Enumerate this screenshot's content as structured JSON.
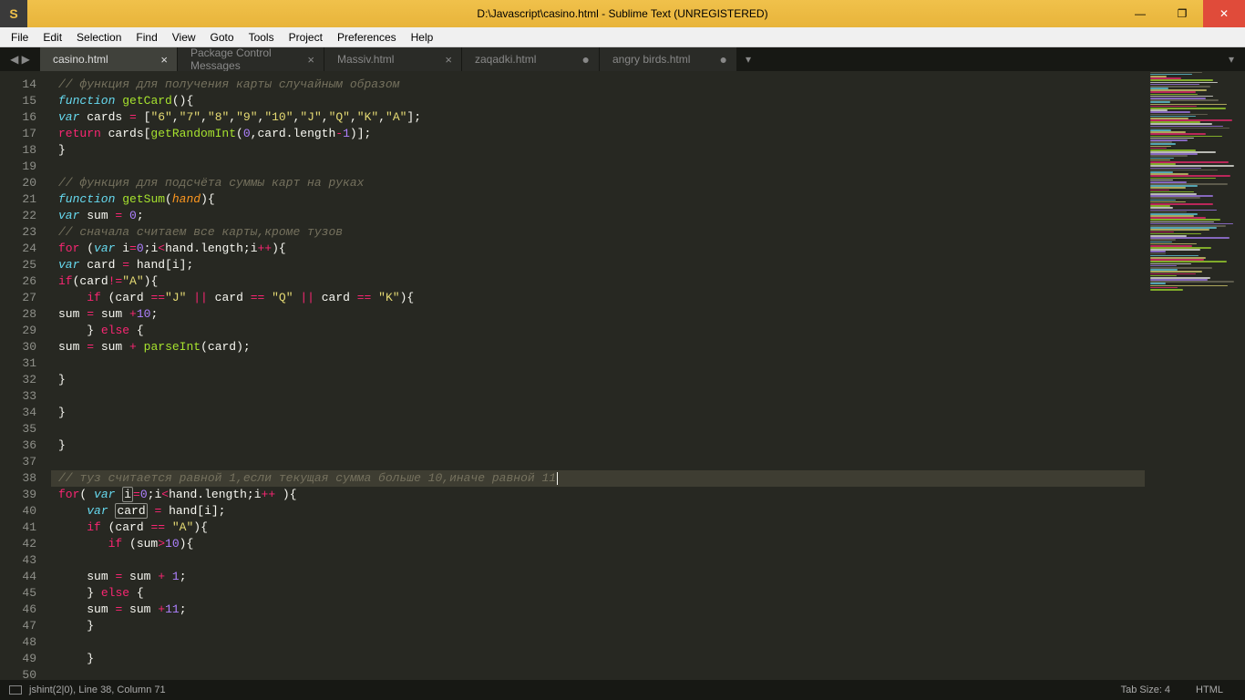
{
  "window": {
    "title": "D:\\Javascript\\casino.html - Sublime Text (UNREGISTERED)",
    "logo": "S"
  },
  "menu": {
    "items": [
      "File",
      "Edit",
      "Selection",
      "Find",
      "View",
      "Goto",
      "Tools",
      "Project",
      "Preferences",
      "Help"
    ]
  },
  "tabs": {
    "items": [
      {
        "label": "casino.html",
        "active": true,
        "close": true,
        "dirty": false
      },
      {
        "label": "Package Control Messages",
        "active": false,
        "close": true,
        "dirty": false
      },
      {
        "label": "Massiv.html",
        "active": false,
        "close": true,
        "dirty": false
      },
      {
        "label": "zaqadki.html",
        "active": false,
        "close": false,
        "dirty": true
      },
      {
        "label": "angry birds.html",
        "active": false,
        "close": false,
        "dirty": true
      }
    ]
  },
  "code": {
    "first_line": 14,
    "highlight_line": 38,
    "modified_lines": [
      39,
      40
    ],
    "lines": [
      {
        "t": "comment",
        "text": "// функция для получения карты случайным образом"
      },
      {
        "t": "fn_decl",
        "parts": {
          "kw": "function",
          "name": "getCard",
          "after": "(){"
        }
      },
      {
        "t": "var_arr",
        "parts": {
          "kw": "var",
          "name": "cards",
          "eq": " = [",
          "arr": [
            "\"6\"",
            "\"7\"",
            "\"8\"",
            "\"9\"",
            "\"10\"",
            "\"J\"",
            "\"Q\"",
            "\"K\"",
            "\"A\""
          ],
          "end": "];"
        }
      },
      {
        "t": "return_call",
        "parts": {
          "kw": "return",
          "rest1": " cards[",
          "fn": "getRandomInt",
          "args_open": "(",
          "n1": "0",
          "comma": ",card.length",
          "op": "-",
          "n2": "1",
          "close": ")];"
        }
      },
      {
        "t": "plain",
        "text": "}"
      },
      {
        "t": "blank",
        "text": ""
      },
      {
        "t": "comment",
        "text": "// функция для подсчёта суммы карт на руках"
      },
      {
        "t": "fn_decl_p",
        "parts": {
          "kw": "function",
          "name": "getSum",
          "paren": "(",
          "param": "hand",
          "close": "){"
        }
      },
      {
        "t": "var_num",
        "parts": {
          "kw": "var",
          "name": "sum",
          "eq": " = ",
          "num": "0",
          "end": ";"
        }
      },
      {
        "t": "comment",
        "text": "// сначала считаем все карты,кроме тузов"
      },
      {
        "t": "for",
        "parts": {
          "kw": "for",
          "open": " (",
          "kw2": "var",
          "name": " i",
          "op": "=",
          "n": "0",
          "mid": ";i",
          "op2": "<",
          "rest": "hand.length;i",
          "op3": "++",
          "close": "){"
        }
      },
      {
        "t": "var_idx",
        "parts": {
          "kw": "var",
          "name": "card",
          "eq": " = hand[i];"
        }
      },
      {
        "t": "if_ne",
        "parts": {
          "kw": "if",
          "open": "(card",
          "op": "!=",
          "s": "\"A\"",
          "close": "){"
        }
      },
      {
        "t": "if_or",
        "parts": {
          "indent": "    ",
          "kw": "if",
          "open": " (card ",
          "op": "==",
          "s1": "\"J\"",
          "bar1": " || ",
          "mid1": "card ",
          "op2": "==",
          "sp2": " ",
          "s2": "\"Q\"",
          "bar2": " || ",
          "mid2": "card ",
          "op3": "==",
          "sp3": " ",
          "s3": "\"K\"",
          "close": "){"
        }
      },
      {
        "t": "assign_plus",
        "parts": {
          "lhs": "sum ",
          "op": "=",
          "rhs": " sum ",
          "op2": "+",
          "n": "10",
          "end": ";"
        }
      },
      {
        "t": "else",
        "parts": {
          "indent": "    ",
          "close": "}",
          "kw": "else",
          "open": " {"
        }
      },
      {
        "t": "assign_call",
        "parts": {
          "lhs": "sum ",
          "op": "=",
          "rhs": " sum ",
          "op2": "+",
          "sp": " ",
          "fn": "parseInt",
          "args": "(card);"
        }
      },
      {
        "t": "blank",
        "text": ""
      },
      {
        "t": "plain",
        "text": "}"
      },
      {
        "t": "blank",
        "text": ""
      },
      {
        "t": "plain",
        "text": "}"
      },
      {
        "t": "blank",
        "text": ""
      },
      {
        "t": "plain",
        "text": "}"
      },
      {
        "t": "blank",
        "text": ""
      },
      {
        "t": "comment_cursor",
        "text": "// туз считается равной 1,если текущая сумма больше 10,иначе равной 11"
      },
      {
        "t": "for2",
        "parts": {
          "kw": "for",
          "open": "( ",
          "kw2": "var",
          "sp": " ",
          "box": "i",
          "op": "=",
          "n": "0",
          "mid": ";i",
          "op2": "<",
          "rest": "hand.length;i",
          "op3": "++",
          "close": " ){"
        }
      },
      {
        "t": "var_box",
        "parts": {
          "indent": "    ",
          "kw": "var",
          "sp": " ",
          "box": "card",
          "eq": " = hand[i];"
        }
      },
      {
        "t": "if_eq",
        "parts": {
          "indent": "    ",
          "kw": "if",
          "open": " (card ",
          "op": "==",
          "sp": " ",
          "s": "\"A\"",
          "close": "){"
        }
      },
      {
        "t": "if_gt",
        "parts": {
          "indent": "       ",
          "kw": "if",
          "open": " (sum",
          "op": ">",
          "n": "10",
          "close": "){"
        }
      },
      {
        "t": "blank",
        "text": ""
      },
      {
        "t": "assign_plus2",
        "parts": {
          "indent": "    ",
          "lhs": "sum ",
          "op": "=",
          "rhs": " sum ",
          "op2": "+",
          "sp": " ",
          "n": "1",
          "end": ";"
        }
      },
      {
        "t": "else",
        "parts": {
          "indent": "    ",
          "close": "}",
          "kw": "else",
          "open": " {"
        }
      },
      {
        "t": "assign_plus2",
        "parts": {
          "indent": "    ",
          "lhs": "sum ",
          "op": "=",
          "rhs": " sum ",
          "op2": "+",
          "sp": "",
          "n": "11",
          "end": ";"
        }
      },
      {
        "t": "plain_i",
        "parts": {
          "indent": "    ",
          "text": "}"
        }
      },
      {
        "t": "blank",
        "text": ""
      },
      {
        "t": "plain_i",
        "parts": {
          "indent": "    ",
          "text": "}"
        }
      },
      {
        "t": "blank",
        "text": ""
      }
    ]
  },
  "status": {
    "left": "jshint(2|0), Line 38, Column 71",
    "tabsize": "Tab Size: 4",
    "syntax": "HTML"
  }
}
